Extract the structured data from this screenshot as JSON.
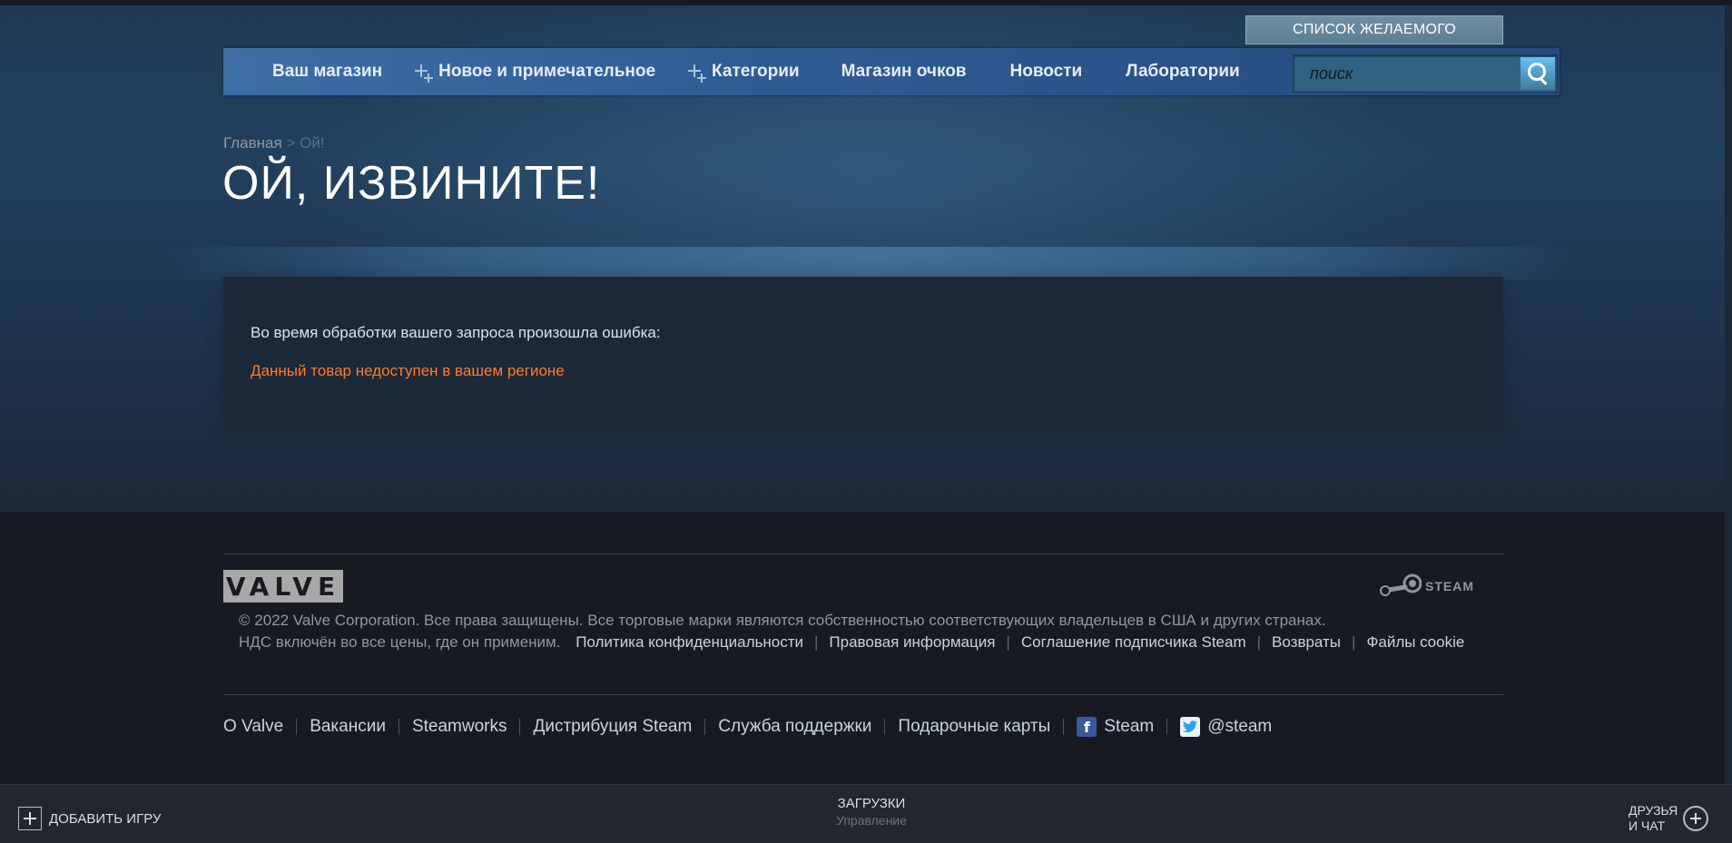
{
  "header": {
    "wishlist_label": "СПИСОК ЖЕЛАЕМОГО",
    "search_placeholder": "поиск"
  },
  "nav": {
    "items": [
      {
        "label": "Ваш магазин",
        "has_plus": false
      },
      {
        "label": "Новое и примечательное",
        "has_plus": true
      },
      {
        "label": "Категории",
        "has_plus": true
      },
      {
        "label": "Магазин очков",
        "has_plus": false
      },
      {
        "label": "Новости",
        "has_plus": false
      },
      {
        "label": "Лаборатории",
        "has_plus": false
      }
    ]
  },
  "breadcrumb": {
    "home": "Главная",
    "separator": ">",
    "current": "Ой!"
  },
  "page": {
    "title": "ОЙ, ИЗВИНИТЕ!",
    "error_message": "Во время обработки вашего запроса произошла ошибка:",
    "error_detail": "Данный товар недоступен в вашем регионе"
  },
  "footer": {
    "valve_logo": "VALVE",
    "steam_logo": "STEAM",
    "copyright": "© 2022 Valve Corporation. Все права защищены. Все торговые марки являются собственностью соответствующих владельцев в США и других странах.",
    "vat_notice": "НДС включён во все цены, где он применим.",
    "legal_links": [
      "Политика конфиденциальности",
      "Правовая информация",
      "Соглашение подписчика Steam",
      "Возвраты",
      "Файлы cookie"
    ],
    "links": [
      "О Valve",
      "Вакансии",
      "Steamworks",
      "Дистрибуция Steam",
      "Служба поддержки",
      "Подарочные карты"
    ],
    "facebook_label": "Steam",
    "twitter_label": "@steam"
  },
  "bottombar": {
    "add_game": "ДОБАВИТЬ ИГРУ",
    "downloads_title": "ЗАГРУЗКИ",
    "downloads_sub": "Управление",
    "friends_line1": "ДРУЗЬЯ",
    "friends_line2": "И ЧАТ"
  },
  "colors": {
    "accent_orange": "#ff7b2b",
    "background": "#1b2838",
    "footer_bg": "#171a21"
  }
}
